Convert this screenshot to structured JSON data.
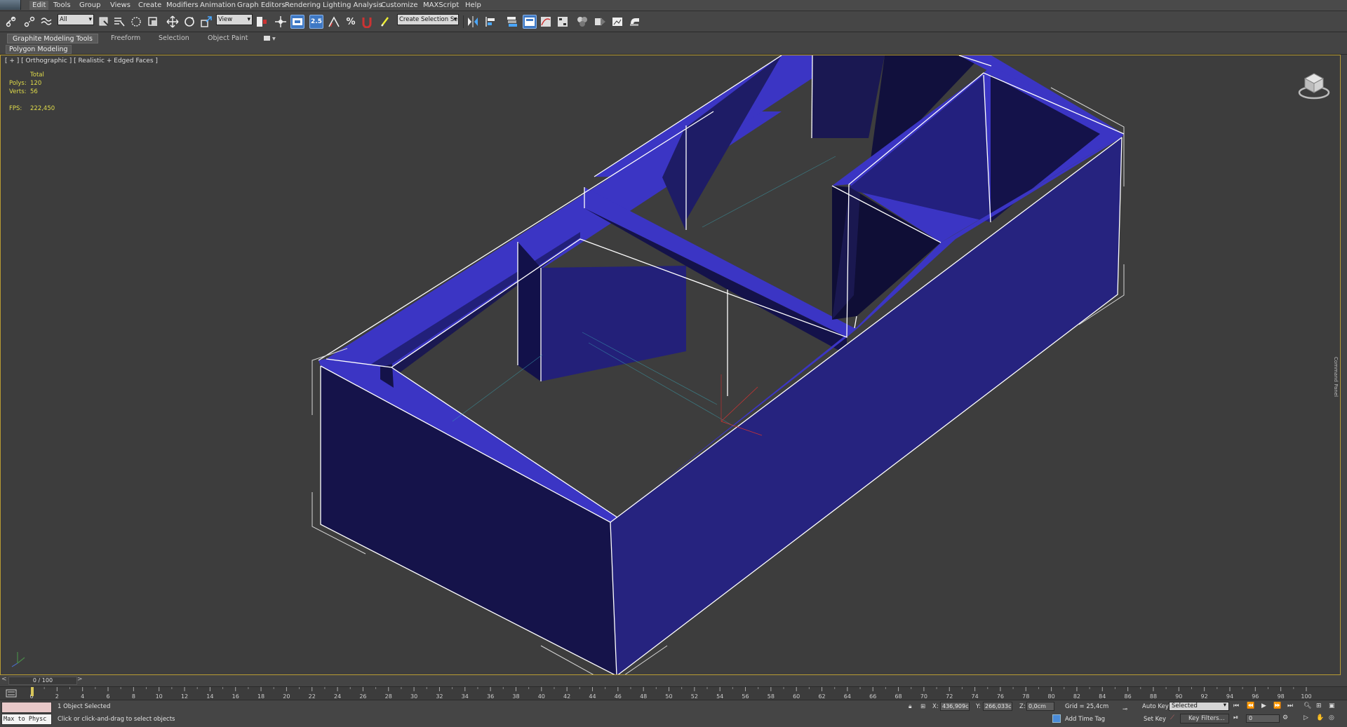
{
  "menu": {
    "items": [
      "Edit",
      "Tools",
      "Group",
      "Views",
      "Create",
      "Modifiers",
      "Animation",
      "Graph Editors",
      "Rendering",
      "Lighting Analysis",
      "Customize",
      "MAXScript",
      "Help"
    ]
  },
  "toolbar": {
    "selection_filter": "All",
    "reference_coord": "View",
    "snap_label": "2.5",
    "named_selection_placeholder": "Create Selection Se"
  },
  "ribbon": {
    "tabs": [
      "Graphite Modeling Tools",
      "Freeform",
      "Selection",
      "Object Paint"
    ],
    "panel_label": "Polygon Modeling"
  },
  "viewport": {
    "label": "[ + ] [ Orthographic ] [ Realistic + Edged Faces ]",
    "stats": {
      "header": "Total",
      "polys_label": "Polys:",
      "polys_value": "120",
      "verts_label": "Verts:",
      "verts_value": "56",
      "fps_label": "FPS:",
      "fps_value": "222,450"
    },
    "object_color": "#2c2a9a",
    "side_panel_label": "Command Panel"
  },
  "timeline": {
    "frame_label": "0 / 100",
    "ticks": [
      "0",
      "2",
      "4",
      "6",
      "8",
      "10",
      "12",
      "14",
      "16",
      "18",
      "20",
      "22",
      "24",
      "26",
      "28",
      "30",
      "32",
      "34",
      "36",
      "38",
      "40",
      "42",
      "44",
      "46",
      "48",
      "50",
      "52",
      "54",
      "56",
      "58",
      "60",
      "62",
      "64",
      "66",
      "68",
      "70",
      "72",
      "74",
      "76",
      "78",
      "80",
      "82",
      "84",
      "86",
      "88",
      "90",
      "92",
      "94",
      "96",
      "98",
      "100"
    ]
  },
  "status": {
    "maxscript_input": "Max to Physc",
    "selected_text": "1 Object Selected",
    "prompt_text": "Click or click-and-drag to select objects",
    "x_label": "X:",
    "x_value": "436,909cm",
    "y_label": "Y:",
    "y_value": "266,033cm",
    "z_label": "Z:",
    "z_value": "0,0cm",
    "grid_text": "Grid = 25,4cm",
    "add_time_tag": "Add Time Tag",
    "auto_key": "Auto Key",
    "set_key": "Set Key",
    "key_mode": "Selected",
    "key_filters": "Key Filters...",
    "frame_value": "0"
  }
}
